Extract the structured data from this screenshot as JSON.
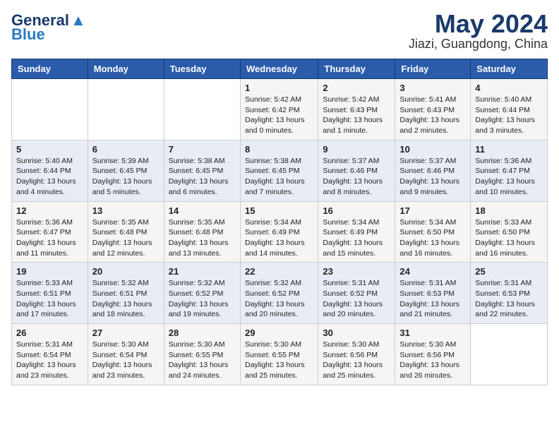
{
  "logo": {
    "general": "General",
    "blue": "Blue",
    "tagline": "GeneralBlue"
  },
  "title": "May 2024",
  "subtitle": "Jiazi, Guangdong, China",
  "days_of_week": [
    "Sunday",
    "Monday",
    "Tuesday",
    "Wednesday",
    "Thursday",
    "Friday",
    "Saturday"
  ],
  "weeks": [
    [
      {
        "day": "",
        "info": ""
      },
      {
        "day": "",
        "info": ""
      },
      {
        "day": "",
        "info": ""
      },
      {
        "day": "1",
        "info": "Sunrise: 5:42 AM\nSunset: 6:42 PM\nDaylight: 13 hours\nand 0 minutes."
      },
      {
        "day": "2",
        "info": "Sunrise: 5:42 AM\nSunset: 6:43 PM\nDaylight: 13 hours\nand 1 minute."
      },
      {
        "day": "3",
        "info": "Sunrise: 5:41 AM\nSunset: 6:43 PM\nDaylight: 13 hours\nand 2 minutes."
      },
      {
        "day": "4",
        "info": "Sunrise: 5:40 AM\nSunset: 6:44 PM\nDaylight: 13 hours\nand 3 minutes."
      }
    ],
    [
      {
        "day": "5",
        "info": "Sunrise: 5:40 AM\nSunset: 6:44 PM\nDaylight: 13 hours\nand 4 minutes."
      },
      {
        "day": "6",
        "info": "Sunrise: 5:39 AM\nSunset: 6:45 PM\nDaylight: 13 hours\nand 5 minutes."
      },
      {
        "day": "7",
        "info": "Sunrise: 5:38 AM\nSunset: 6:45 PM\nDaylight: 13 hours\nand 6 minutes."
      },
      {
        "day": "8",
        "info": "Sunrise: 5:38 AM\nSunset: 6:45 PM\nDaylight: 13 hours\nand 7 minutes."
      },
      {
        "day": "9",
        "info": "Sunrise: 5:37 AM\nSunset: 6:46 PM\nDaylight: 13 hours\nand 8 minutes."
      },
      {
        "day": "10",
        "info": "Sunrise: 5:37 AM\nSunset: 6:46 PM\nDaylight: 13 hours\nand 9 minutes."
      },
      {
        "day": "11",
        "info": "Sunrise: 5:36 AM\nSunset: 6:47 PM\nDaylight: 13 hours\nand 10 minutes."
      }
    ],
    [
      {
        "day": "12",
        "info": "Sunrise: 5:36 AM\nSunset: 6:47 PM\nDaylight: 13 hours\nand 11 minutes."
      },
      {
        "day": "13",
        "info": "Sunrise: 5:35 AM\nSunset: 6:48 PM\nDaylight: 13 hours\nand 12 minutes."
      },
      {
        "day": "14",
        "info": "Sunrise: 5:35 AM\nSunset: 6:48 PM\nDaylight: 13 hours\nand 13 minutes."
      },
      {
        "day": "15",
        "info": "Sunrise: 5:34 AM\nSunset: 6:49 PM\nDaylight: 13 hours\nand 14 minutes."
      },
      {
        "day": "16",
        "info": "Sunrise: 5:34 AM\nSunset: 6:49 PM\nDaylight: 13 hours\nand 15 minutes."
      },
      {
        "day": "17",
        "info": "Sunrise: 5:34 AM\nSunset: 6:50 PM\nDaylight: 13 hours\nand 16 minutes."
      },
      {
        "day": "18",
        "info": "Sunrise: 5:33 AM\nSunset: 6:50 PM\nDaylight: 13 hours\nand 16 minutes."
      }
    ],
    [
      {
        "day": "19",
        "info": "Sunrise: 5:33 AM\nSunset: 6:51 PM\nDaylight: 13 hours\nand 17 minutes."
      },
      {
        "day": "20",
        "info": "Sunrise: 5:32 AM\nSunset: 6:51 PM\nDaylight: 13 hours\nand 18 minutes."
      },
      {
        "day": "21",
        "info": "Sunrise: 5:32 AM\nSunset: 6:52 PM\nDaylight: 13 hours\nand 19 minutes."
      },
      {
        "day": "22",
        "info": "Sunrise: 5:32 AM\nSunset: 6:52 PM\nDaylight: 13 hours\nand 20 minutes."
      },
      {
        "day": "23",
        "info": "Sunrise: 5:31 AM\nSunset: 6:52 PM\nDaylight: 13 hours\nand 20 minutes."
      },
      {
        "day": "24",
        "info": "Sunrise: 5:31 AM\nSunset: 6:53 PM\nDaylight: 13 hours\nand 21 minutes."
      },
      {
        "day": "25",
        "info": "Sunrise: 5:31 AM\nSunset: 6:53 PM\nDaylight: 13 hours\nand 22 minutes."
      }
    ],
    [
      {
        "day": "26",
        "info": "Sunrise: 5:31 AM\nSunset: 6:54 PM\nDaylight: 13 hours\nand 23 minutes."
      },
      {
        "day": "27",
        "info": "Sunrise: 5:30 AM\nSunset: 6:54 PM\nDaylight: 13 hours\nand 23 minutes."
      },
      {
        "day": "28",
        "info": "Sunrise: 5:30 AM\nSunset: 6:55 PM\nDaylight: 13 hours\nand 24 minutes."
      },
      {
        "day": "29",
        "info": "Sunrise: 5:30 AM\nSunset: 6:55 PM\nDaylight: 13 hours\nand 25 minutes."
      },
      {
        "day": "30",
        "info": "Sunrise: 5:30 AM\nSunset: 6:56 PM\nDaylight: 13 hours\nand 25 minutes."
      },
      {
        "day": "31",
        "info": "Sunrise: 5:30 AM\nSunset: 6:56 PM\nDaylight: 13 hours\nand 26 minutes."
      },
      {
        "day": "",
        "info": ""
      }
    ]
  ]
}
